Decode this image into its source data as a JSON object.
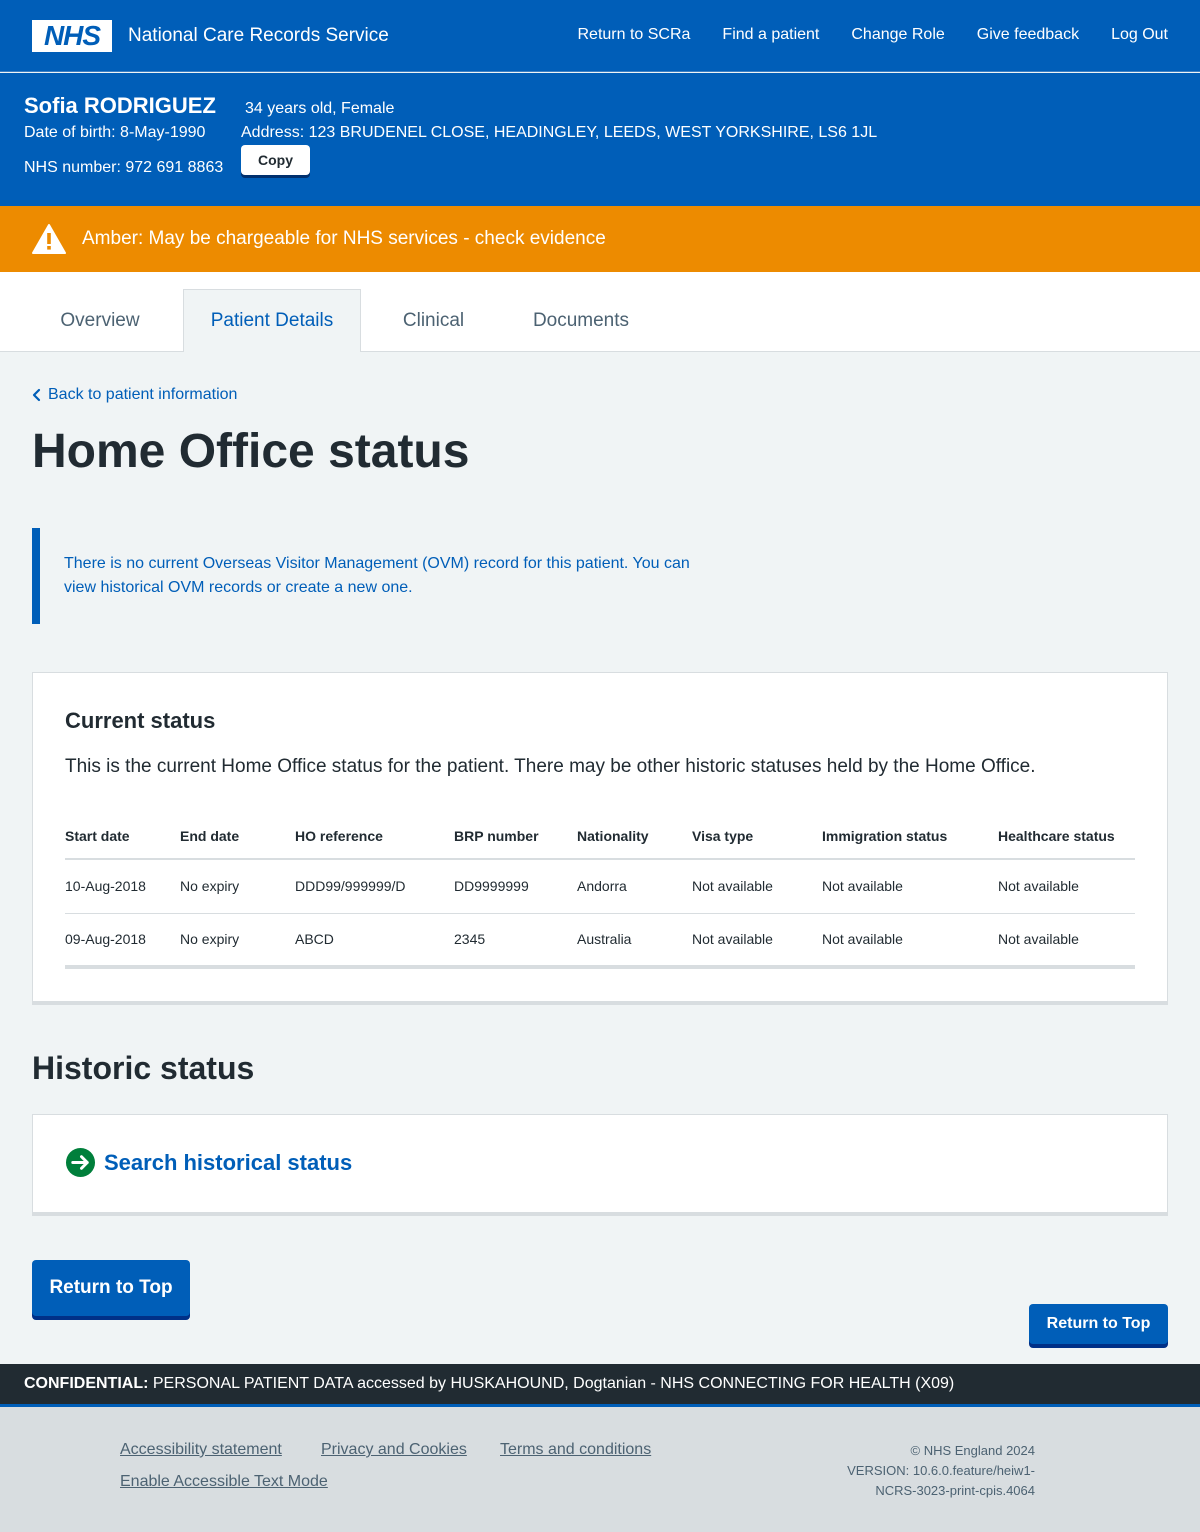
{
  "header": {
    "logo": "NHS",
    "service_name": "National Care Records Service",
    "nav": [
      "Return to SCRa",
      "Find a patient",
      "Change Role",
      "Give feedback",
      "Log Out"
    ]
  },
  "patient": {
    "name": "Sofia RODRIGUEZ",
    "age_gender": "34 years old, Female",
    "dob": "Date of birth: 8-May-1990",
    "address": "Address: 123 BRUDENEL CLOSE, HEADINGLEY, LEEDS, WEST YORKSHIRE, LS6 1JL",
    "nhs_number": "NHS number: 972 691 8863",
    "copy_label": "Copy"
  },
  "alert": {
    "text": "Amber: May be chargeable for NHS services - check evidence",
    "color": "#ed8b00"
  },
  "tabs": [
    "Overview",
    "Patient Details",
    "Clinical",
    "Documents"
  ],
  "active_tab": "Patient Details",
  "main": {
    "back_link": "Back to patient information",
    "title": "Home Office status",
    "inset_text": "There is no current Overseas Visitor Management (OVM) record for this patient. You can view historical OVM records or create a new one."
  },
  "current_status": {
    "title": "Current status",
    "description": "This is the current Home Office status for the patient. There may be other historic statuses held by the Home Office.",
    "columns": [
      "Start date",
      "End date",
      "HO reference",
      "BRP number",
      "Nationality",
      "Visa type",
      "Immigration status",
      "Healthcare status"
    ],
    "rows": [
      [
        "10-Aug-2018",
        "No expiry",
        "DDD99/999999/D",
        "DD9999999",
        "Andorra",
        "Not available",
        "Not available",
        "Not available"
      ],
      [
        "09-Aug-2018",
        "No expiry",
        "ABCD",
        "2345",
        "Australia",
        "Not available",
        "Not available",
        "Not available"
      ]
    ]
  },
  "historic": {
    "title": "Historic status",
    "link": "Search historical status"
  },
  "buttons": {
    "return_top": "Return to Top"
  },
  "confidential": {
    "label": "CONFIDENTIAL:",
    "text": " PERSONAL PATIENT DATA accessed by HUSKAHOUND, Dogtanian - NHS CONNECTING FOR HEALTH (X09)"
  },
  "footer": {
    "links": [
      "Accessibility statement",
      "Privacy and Cookies",
      "Terms and conditions",
      "Enable Accessible Text Mode"
    ],
    "copyright": "© NHS England 2024",
    "version": "VERSION: 10.6.0.feature/heiw1-NCRS-3023-print-cpis.4064"
  }
}
